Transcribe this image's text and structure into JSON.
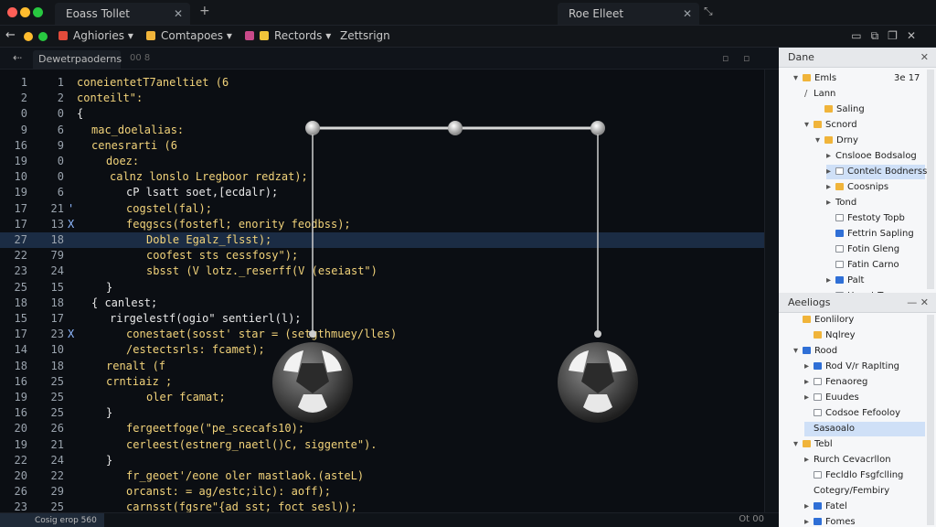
{
  "window": {
    "tab1_title": "Eoass Tollet",
    "tab2_title": "Roe Elleet"
  },
  "toolbar": {
    "menus": [
      "Aghiories ▾",
      "Comtapoes ▾",
      "Rectords ▾",
      "Zettsrign"
    ]
  },
  "editor": {
    "tab_label": "Dewetrpaoderns",
    "tab2_label": "00 8",
    "lines": [
      {
        "n1": "1",
        "n2": "1",
        "mark": "",
        "indent": 84,
        "text": "coneientetT7aneltiet (6",
        "cls": "k-yel"
      },
      {
        "n1": "2",
        "n2": "2",
        "mark": "",
        "indent": 84,
        "text": "conteilt\":",
        "cls": "k-yel"
      },
      {
        "n1": "0",
        "n2": "0",
        "mark": "",
        "indent": 84,
        "text": "{",
        "cls": "k-wht"
      },
      {
        "n1": "9",
        "n2": "6",
        "mark": "",
        "indent": 100,
        "text": "mac_doelalias:",
        "cls": "k-yel"
      },
      {
        "n1": "16",
        "n2": "9",
        "mark": "",
        "indent": 100,
        "text": "cenesrarti (6",
        "cls": "k-yel"
      },
      {
        "n1": "19",
        "n2": "0",
        "mark": "",
        "indent": 116,
        "text": "doez:",
        "cls": "k-yel"
      },
      {
        "n1": "10",
        "n2": "0",
        "mark": "",
        "indent": 120,
        "text": "calnz lonslo Lregboor redzat);",
        "cls": "k-yel"
      },
      {
        "n1": "19",
        "n2": "6",
        "mark": "",
        "indent": 138,
        "text": "cP lsatt soet,[ecdalr);",
        "cls": "k-wht"
      },
      {
        "n1": "17",
        "n2": "21",
        "mark": "'",
        "indent": 138,
        "text": "cogstel(fal);",
        "cls": "k-yel"
      },
      {
        "n1": "17",
        "n2": "13",
        "mark": "X",
        "indent": 138,
        "text": "feqgscs(fostefl; enority feodbss);",
        "cls": "k-yel"
      },
      {
        "n1": "27",
        "n2": "18",
        "mark": "",
        "indent": 160,
        "text": "Doble Egalz_flsst);",
        "cls": "k-yel",
        "active": true
      },
      {
        "n1": "22",
        "n2": "79",
        "mark": "",
        "indent": 160,
        "text": "coofest sts cessfosy\");",
        "cls": "k-yel"
      },
      {
        "n1": "23",
        "n2": "24",
        "mark": "",
        "indent": 160,
        "text": "sbsst (V lotz._reserff(V (eseiast\")",
        "cls": "k-yel"
      },
      {
        "n1": "25",
        "n2": "15",
        "mark": "",
        "indent": 116,
        "text": "}",
        "cls": "k-wht"
      },
      {
        "n1": "18",
        "n2": "18",
        "mark": "",
        "indent": 100,
        "text": "{ canlest;",
        "cls": "k-wht"
      },
      {
        "n1": "15",
        "n2": "17",
        "mark": "",
        "indent": 120,
        "text": "rirgelestf(ogio\" sentierl(l);",
        "cls": "k-wht"
      },
      {
        "n1": "17",
        "n2": "23",
        "mark": "X",
        "indent": 138,
        "text": "conestaet(sosst' star = (setgthmuey/lles)",
        "cls": "k-yel"
      },
      {
        "n1": "14",
        "n2": "10",
        "mark": "",
        "indent": 138,
        "text": "/estectsrls: fcamet);",
        "cls": "k-yel"
      },
      {
        "n1": "18",
        "n2": "18",
        "mark": "",
        "indent": 116,
        "text": "renalt (f",
        "cls": "k-yel"
      },
      {
        "n1": "16",
        "n2": "25",
        "mark": "",
        "indent": 116,
        "text": "crntiaiz ;",
        "cls": "k-yel"
      },
      {
        "n1": "19",
        "n2": "25",
        "mark": "",
        "indent": 160,
        "text": "oler fcamat;",
        "cls": "k-yel"
      },
      {
        "n1": "16",
        "n2": "25",
        "mark": "",
        "indent": 116,
        "text": "}",
        "cls": "k-wht"
      },
      {
        "n1": "20",
        "n2": "26",
        "mark": "",
        "indent": 138,
        "text": "fergeetfoge(\"pe_scecafs10);",
        "cls": "k-yel"
      },
      {
        "n1": "19",
        "n2": "21",
        "mark": "",
        "indent": 138,
        "text": "cerleest(estnerg_naetl()C, siggente\").",
        "cls": "k-yel"
      },
      {
        "n1": "22",
        "n2": "24",
        "mark": "",
        "indent": 116,
        "text": "}",
        "cls": "k-wht"
      },
      {
        "n1": "20",
        "n2": "22",
        "mark": "",
        "indent": 138,
        "text": "fr_geoet'/eone oler mastlaok.(asteL)",
        "cls": "k-yel"
      },
      {
        "n1": "26",
        "n2": "29",
        "mark": "",
        "indent": 138,
        "text": "orcanst: = ag/estc;ilc): aoff);",
        "cls": "k-yel"
      },
      {
        "n1": "23",
        "n2": "25",
        "mark": "",
        "indent": 138,
        "text": "carnsst(fgsre\"{ad sst; foct sesl));",
        "cls": "k-yel"
      }
    ]
  },
  "explorer": {
    "header": "Dane",
    "count": "3e 17",
    "items": [
      {
        "label": "Emls",
        "depth": 0,
        "chev": "▾",
        "icon": "folder"
      },
      {
        "label": "Lann",
        "depth": 1,
        "chev": "/",
        "icon": ""
      },
      {
        "label": "Saling",
        "depth": 2,
        "chev": "",
        "icon": "folder"
      },
      {
        "label": "Scnord",
        "depth": 1,
        "chev": "▾",
        "icon": "folder"
      },
      {
        "label": "Drny",
        "depth": 2,
        "chev": "▾",
        "icon": "folder"
      },
      {
        "label": "Cnslooe Bodsalog",
        "depth": 3,
        "chev": "▸",
        "icon": ""
      },
      {
        "label": "Contelc Bodnerss",
        "depth": 3,
        "chev": "▸",
        "icon": "file",
        "selected": true
      },
      {
        "label": "Coosnips",
        "depth": 3,
        "chev": "▸",
        "icon": "folder"
      },
      {
        "label": "Tond",
        "depth": 3,
        "chev": "▸",
        "icon": ""
      },
      {
        "label": "Festoty Topb",
        "depth": 3,
        "chev": "",
        "icon": "file"
      },
      {
        "label": "Fettrin Sapling",
        "depth": 3,
        "chev": "",
        "icon": "blue"
      },
      {
        "label": "Fotin Gleng",
        "depth": 3,
        "chev": "",
        "icon": "file"
      },
      {
        "label": "Fatin Carno",
        "depth": 3,
        "chev": "",
        "icon": "file"
      },
      {
        "label": "Palt",
        "depth": 3,
        "chev": "▸",
        "icon": "blue"
      },
      {
        "label": "Hgaet Ts",
        "depth": 3,
        "chev": "",
        "icon": "file"
      }
    ]
  },
  "settings": {
    "header": "Aeeliogs",
    "items": [
      {
        "label": "Eonlilory",
        "depth": 0,
        "chev": "",
        "icon": "folder"
      },
      {
        "label": "Nqlrey",
        "depth": 1,
        "chev": "",
        "icon": "folder"
      },
      {
        "label": "Rood",
        "depth": 0,
        "chev": "▾",
        "icon": "blue"
      },
      {
        "label": "Rod V/r Raplting",
        "depth": 1,
        "chev": "▸",
        "icon": "blue"
      },
      {
        "label": "Fenaoreg",
        "depth": 1,
        "chev": "▸",
        "icon": "file"
      },
      {
        "label": "Euudes",
        "depth": 1,
        "chev": "▸",
        "icon": "file"
      },
      {
        "label": "Codsoe Fefooloy",
        "depth": 1,
        "chev": "",
        "icon": "file"
      },
      {
        "label": "Sasaoalo",
        "depth": 1,
        "chev": "",
        "icon": "",
        "selected": true
      },
      {
        "label": "Tebl",
        "depth": 0,
        "chev": "▾",
        "icon": "folder"
      },
      {
        "label": "Rurch Cevacrllon",
        "depth": 1,
        "chev": "▸",
        "icon": ""
      },
      {
        "label": "Fecldlo Fsgfclling",
        "depth": 1,
        "chev": "",
        "icon": "file"
      },
      {
        "label": "Cotegry/Fembiry",
        "depth": 1,
        "chev": "",
        "icon": ""
      },
      {
        "label": "Fatel",
        "depth": 1,
        "chev": "▸",
        "icon": "blue"
      },
      {
        "label": "Fomes",
        "depth": 1,
        "chev": "▸",
        "icon": "blue"
      }
    ]
  },
  "status": {
    "left": "Cosig erop 560",
    "right": "Ot 00"
  }
}
